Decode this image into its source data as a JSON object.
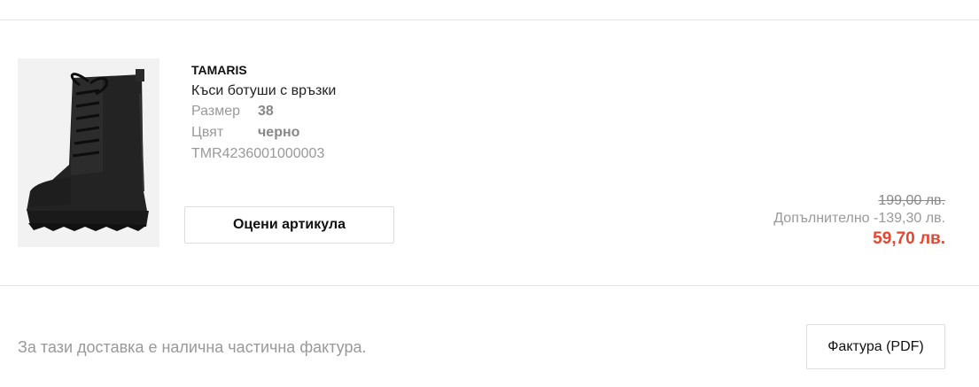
{
  "product": {
    "brand": "TAMARIS",
    "name": "Къси ботуши с връзки",
    "size_label": "Размер",
    "size_value": "38",
    "color_label": "Цвят",
    "color_value": "черно",
    "sku": "TMR4236001000003",
    "image_icon": "black-lace-up-boot-image"
  },
  "actions": {
    "rate_label": "Оцени артикула"
  },
  "pricing": {
    "old_price": "199,00 лв.",
    "extra_discount": "Допълнително -139,30 лв.",
    "final_price": "59,70 лв.",
    "final_price_color": "#e8452f"
  },
  "invoice": {
    "note": "За тази доставка е налична частична фактура.",
    "button_label": "Фактура (PDF)"
  }
}
